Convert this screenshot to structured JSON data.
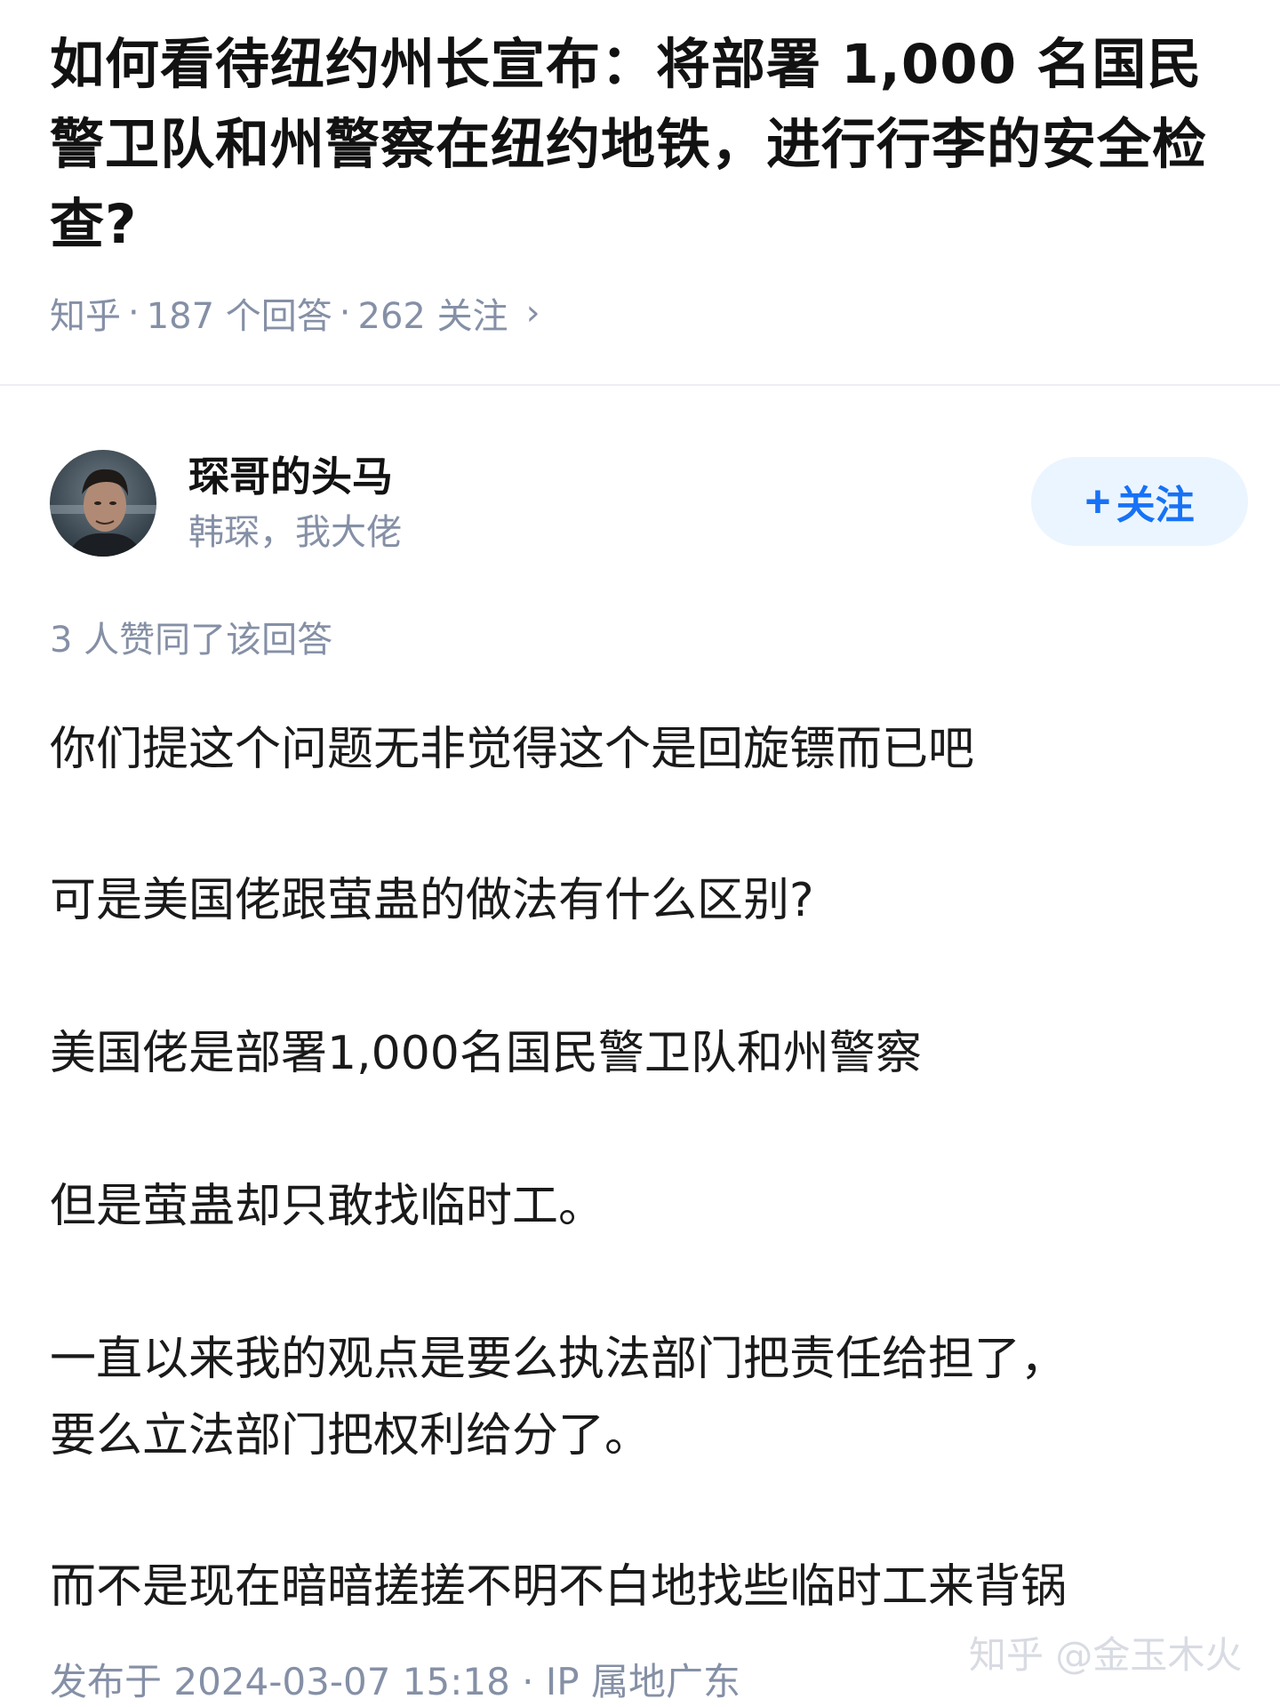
{
  "question": {
    "title": "如何看待纽约州长宣布：将部署 1,000 名国民警卫队和州警察在纽约地铁，进行行李的安全检查?",
    "source": "知乎",
    "answers_count": "187 个回答",
    "followers_count": "262 关注",
    "separator": "·",
    "chevron": "›"
  },
  "author": {
    "name": "琛哥的头马",
    "bio": "韩琛，我大佬",
    "follow_label": "关注",
    "follow_plus": "+"
  },
  "answer": {
    "upvotes_text": "3 人赞同了该回答",
    "paragraphs": [
      "你们提这个问题无非觉得这个是回旋镖而已吧",
      "可是美国佬跟萤蛊的做法有什么区别?",
      "美国佬是部署1,000名国民警卫队和州警察",
      "但是萤蛊却只敢找临时工。",
      "一直以来我的观点是要么执法部门把责任给担了，",
      "要么立法部门把权利给分了。",
      "而不是现在暗暗搓搓不明不白地找些临时工来背锅"
    ],
    "footer": "发布于 2024-03-07 15:18 · IP 属地广东"
  },
  "watermark": "知乎 @金玉木火",
  "colors": {
    "accent": "#1772f6",
    "follow_bg": "#ebf5ff",
    "meta_gray": "#8590a6"
  }
}
